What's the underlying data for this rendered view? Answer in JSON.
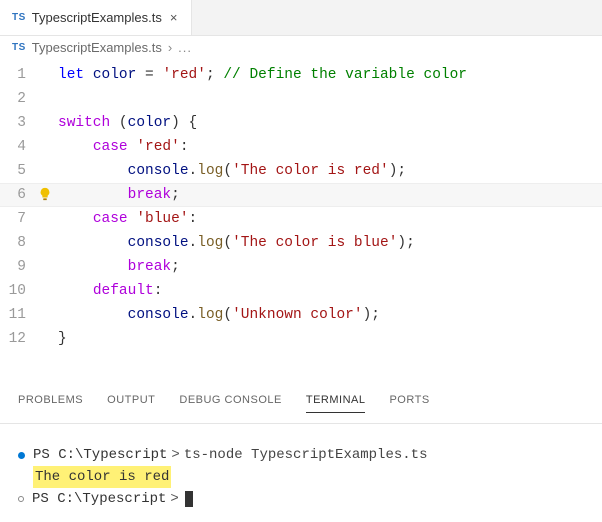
{
  "tab": {
    "lang_badge": "TS",
    "filename": "TypescriptExamples.ts",
    "close_glyph": "×"
  },
  "breadcrumb": {
    "lang_badge": "TS",
    "filename": "TypescriptExamples.ts",
    "chev": "›",
    "dots": "..."
  },
  "code": {
    "l1": {
      "num": "1",
      "kw_let": "let",
      "var_color": "color",
      "eq": " = ",
      "str": "'red'",
      "semi": ";",
      "space": " ",
      "comment": "// Define the variable color"
    },
    "l2": {
      "num": "2"
    },
    "l3": {
      "num": "3",
      "kw_switch": "switch",
      "sp": " ",
      "lp": "(",
      "var_color": "color",
      "rp": ")",
      "sp2": " ",
      "lb": "{"
    },
    "l4": {
      "num": "4",
      "indent": "    ",
      "kw_case": "case",
      "sp": " ",
      "str": "'red'",
      "colon": ":"
    },
    "l5": {
      "num": "5",
      "indent": "        ",
      "obj": "console",
      "dot": ".",
      "fn": "log",
      "lp": "(",
      "str": "'The color is red'",
      "rp": ")",
      "semi": ";"
    },
    "l6": {
      "num": "6",
      "indent": "        ",
      "kw_break": "break",
      "semi": ";"
    },
    "l7": {
      "num": "7",
      "indent": "    ",
      "kw_case": "case",
      "sp": " ",
      "str": "'blue'",
      "colon": ":"
    },
    "l8": {
      "num": "8",
      "indent": "        ",
      "obj": "console",
      "dot": ".",
      "fn": "log",
      "lp": "(",
      "str": "'The color is blue'",
      "rp": ")",
      "semi": ";"
    },
    "l9": {
      "num": "9",
      "indent": "        ",
      "kw_break": "break",
      "semi": ";"
    },
    "l10": {
      "num": "10",
      "indent": "    ",
      "kw_default": "default",
      "colon": ":"
    },
    "l11": {
      "num": "11",
      "indent": "        ",
      "obj": "console",
      "dot": ".",
      "fn": "log",
      "lp": "(",
      "str": "'Unknown color'",
      "rp": ")",
      "semi": ";"
    },
    "l12": {
      "num": "12",
      "rb": "}"
    }
  },
  "panels": {
    "problems": "PROBLEMS",
    "output": "OUTPUT",
    "debug": "DEBUG CONSOLE",
    "terminal": "TERMINAL",
    "ports": "PORTS"
  },
  "terminal": {
    "line1": {
      "prompt": "PS C:\\Typescript",
      "chev": ">",
      "cmd": "ts-node TypescriptExamples.ts"
    },
    "line2": {
      "output": "The color is red"
    },
    "line3": {
      "prompt": "PS C:\\Typescript",
      "chev": ">"
    }
  }
}
